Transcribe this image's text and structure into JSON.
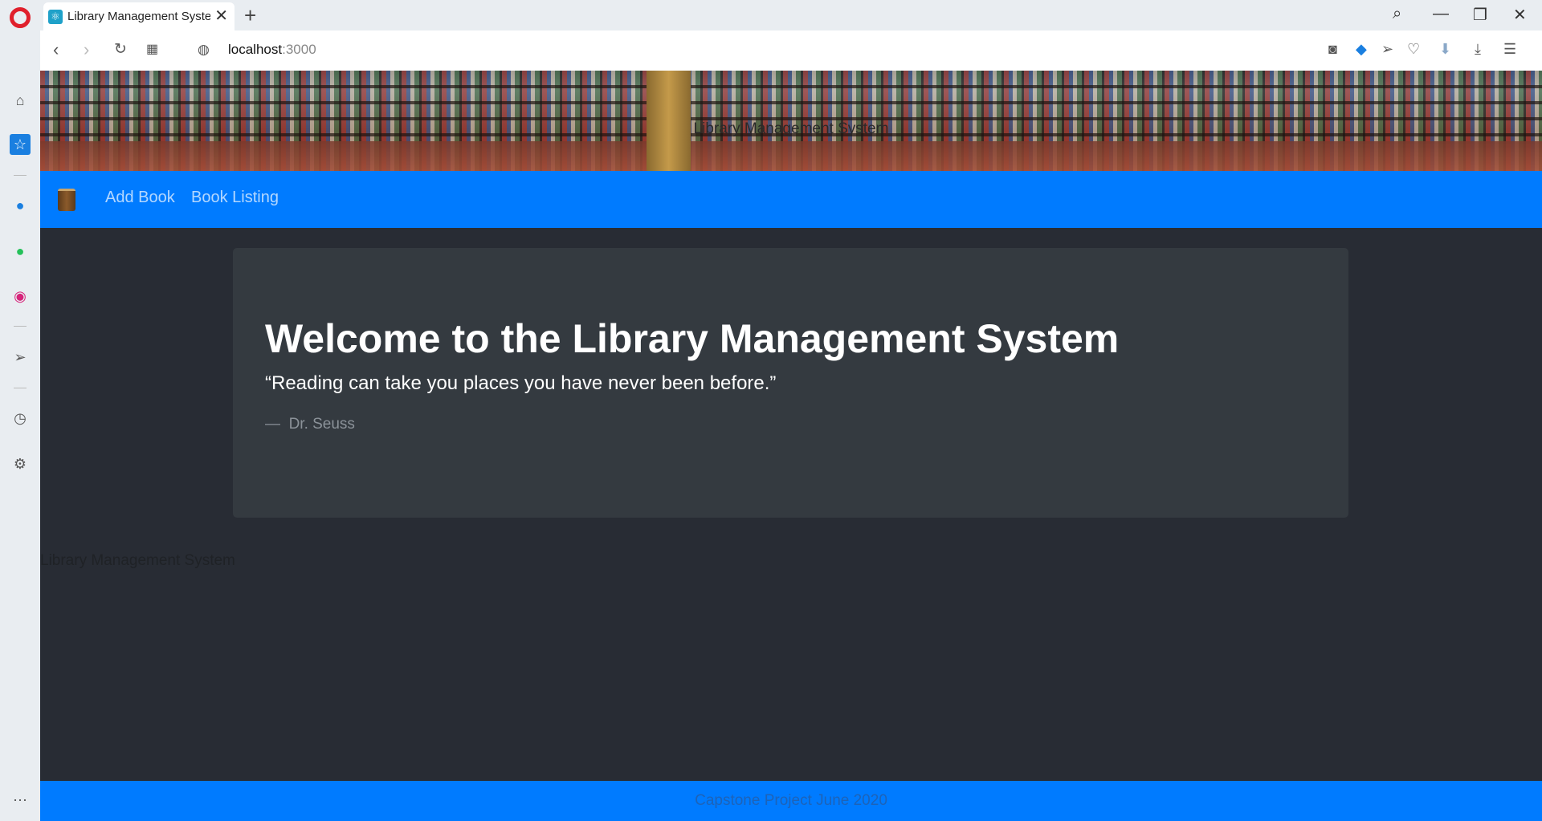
{
  "browser": {
    "tab_title": "Library Management System",
    "url_host": "localhost",
    "url_port": ":3000"
  },
  "page": {
    "banner_title": "Library Management System",
    "nav": {
      "brand_icon": "book-icon",
      "links": [
        "Add Book",
        "Book Listing"
      ]
    },
    "jumbotron": {
      "title": "Welcome to the Library Management System",
      "quote": "“Reading can take you places you have never been before.”",
      "author_prefix": "—",
      "author": "Dr. Seuss"
    },
    "ghost_text": "Library Management System",
    "footer_text": "Capstone Project June 2020"
  },
  "colors": {
    "navbar": "#007bff",
    "background": "#282c34",
    "jumbotron": "#343a40"
  }
}
